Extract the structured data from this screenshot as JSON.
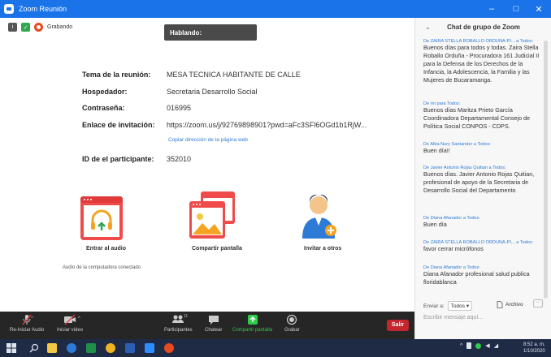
{
  "window": {
    "title": "Zoom Reunión",
    "controls": [
      "–",
      "□",
      "✕"
    ]
  },
  "status": {
    "recording_label": "Grabando"
  },
  "speaking_banner": "Hablando:",
  "meeting_info": {
    "topic_label": "Tema de la reunión:",
    "topic_value": "MESA TECNICA HABITANTE DE CALLE",
    "host_label": "Hospedador:",
    "host_value": "Secretaria Desarrollo Social",
    "password_label": "Contraseña:",
    "password_value": "016995",
    "invite_label": "Enlace de invitación:",
    "invite_value": "https://zoom.us/j/92769898901?pwd=aFc3SFl6OGd1b1RjW...",
    "copy_link_label": "Copiar dirección de la página web",
    "participant_id_label": "ID de el participante:",
    "participant_id_value": "352010"
  },
  "actions": {
    "audio_label": "Entrar al audio",
    "audio_sub": "Audio de la computadora conectado",
    "share_label": "Compartir pantalla",
    "invite_label": "Invitar a otros"
  },
  "toolbar": {
    "audio": "Re-Iniciar Audio",
    "video": "Iniciar video",
    "participants": "Participantes",
    "participants_count": "11",
    "chat": "Chatear",
    "share": "Compartir pantalla",
    "record": "Grabar",
    "leave": "Salir"
  },
  "chat": {
    "title": "Chat de grupo de Zoom",
    "messages": [
      {
        "from": "De ZAIRA STELLA ROBALLO ORDUÑA-PI...",
        "to": "a Todos:",
        "text": "Buenos días para todos y todas. Zaira Stella Roballo Orduña - Procuradora 161 Judicial II para la Defensa de los Derechos de la Infancia, la Adolescencia, la Familia y las Mujeres de Bucaramanga."
      },
      {
        "from": "De mí para",
        "to": "Todos:",
        "text": "Buenos días Maritza Prieto García Coordinadora Departamental Consejo de Política Social CONPOS - CDPS."
      },
      {
        "from": "De Alba Nury Santander",
        "to": "a Todos:",
        "text": "Buen día!!"
      },
      {
        "from": "De Javier Antonio Rojas Quitian",
        "to": "a Todos:",
        "text": "Buenos días. Javier Antonio Rojas Quitian, profesional de apoyo de la Secretaria de Desarrollo Social del Departamento"
      },
      {
        "from": "De Diana Afanador",
        "to": "a Todos:",
        "text": "Buen día"
      },
      {
        "from": "De ZAIRA STELLA ROBALLO ORDUÑA-PI...",
        "to": "a Todos:",
        "text": "favor cerrar micrófonos"
      },
      {
        "from": "De Diana Afanador",
        "to": "a Todos:",
        "text": "Diana Afanador profesional salud publica floridablanca"
      }
    ],
    "send_to_label": "Enviar a:",
    "send_to_value": "Todos",
    "file_label": "Archivo",
    "more_label": "···",
    "input_placeholder": "Escribir mensaje aquí..."
  },
  "taskbar": {
    "time": "8:52 a. m.",
    "date": "1/10/2020"
  },
  "colors": {
    "titlebar": "#1a73e8",
    "toolbar": "#262626",
    "leave": "#c4262d",
    "share_green": "#2fcb4a",
    "link_blue": "#2d7bd6",
    "action_red": "#ef4b4b",
    "taskbar": "#1f2a44"
  }
}
